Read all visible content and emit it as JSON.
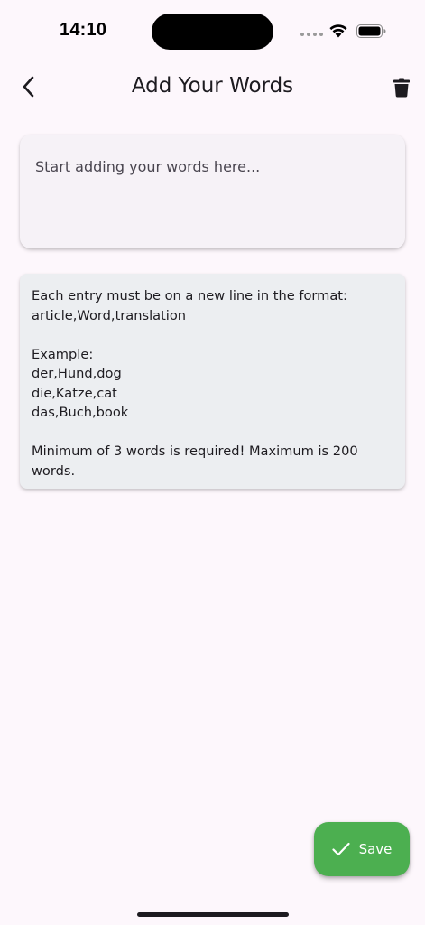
{
  "status_bar": {
    "time": "14:10"
  },
  "app_bar": {
    "title": "Add Your Words",
    "back_icon": "chevron-left",
    "delete_icon": "trash"
  },
  "words_input": {
    "placeholder": "Start adding your words here...",
    "value": ""
  },
  "instructions": {
    "line1": "Each entry must be on a new line in the format:",
    "line2": "article,Word,translation",
    "example_heading": "Example:",
    "examples": [
      "der,Hund,dog",
      "die,Katze,cat",
      "das,Buch,book"
    ],
    "requirement": "Minimum of 3 words is required! Maximum is 200 words."
  },
  "save_button": {
    "label": "Save",
    "icon": "check",
    "color": "#4caf50"
  },
  "colors": {
    "background": "#fdf7fc",
    "input_card": "#f6f2f7",
    "info_card": "#eceef1",
    "text": "#1d1b20"
  }
}
